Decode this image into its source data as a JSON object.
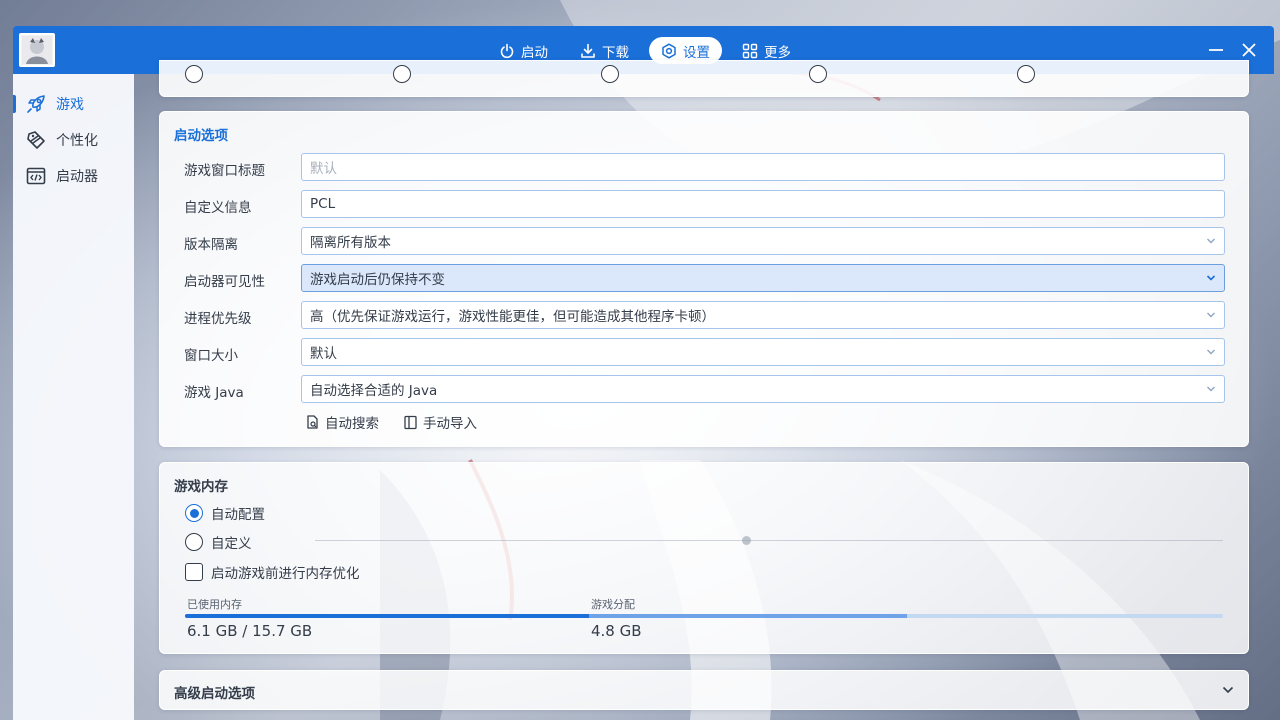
{
  "titlebar": {
    "nav": [
      {
        "label": "启动",
        "icon": "power-icon"
      },
      {
        "label": "下载",
        "icon": "download-icon"
      },
      {
        "label": "设置",
        "icon": "settings-icon",
        "active": true
      },
      {
        "label": "更多",
        "icon": "grid-icon"
      }
    ]
  },
  "sidebar": {
    "items": [
      {
        "label": "游戏",
        "icon": "rocket-icon",
        "active": true
      },
      {
        "label": "个性化",
        "icon": "palette-icon"
      },
      {
        "label": "启动器",
        "icon": "code-window-icon"
      }
    ]
  },
  "launch_options": {
    "title": "启动选项",
    "rows": [
      {
        "label": "游戏窗口标题",
        "placeholder": "默认"
      },
      {
        "label": "自定义信息",
        "value": "PCL"
      },
      {
        "label": "版本隔离",
        "value": "隔离所有版本"
      },
      {
        "label": "启动器可见性",
        "value": "游戏启动后仍保持不变"
      },
      {
        "label": "进程优先级",
        "value": "高（优先保证游戏运行，游戏性能更佳，但可能造成其他程序卡顿）"
      },
      {
        "label": "窗口大小",
        "value": "默认"
      },
      {
        "label": "游戏 Java",
        "value": "自动选择合适的 Java"
      }
    ],
    "auto_search_label": "自动搜索",
    "manual_import_label": "手动导入"
  },
  "memory": {
    "title": "游戏内存",
    "radio_auto": "自动配置",
    "radio_custom": "自定义",
    "optimize_label": "启动游戏前进行内存优化",
    "used_label": "已使用内存",
    "used_value": "6.1 GB / 15.7 GB",
    "alloc_label": "游戏分配",
    "alloc_value": "4.8 GB",
    "used_fraction": 0.389,
    "alloc_fraction": 0.306,
    "custom_slider_fraction": 0.47
  },
  "advanced": {
    "title": "高级启动选项"
  },
  "colors": {
    "accent": "#1a6fd8",
    "text": "#343d4a"
  }
}
